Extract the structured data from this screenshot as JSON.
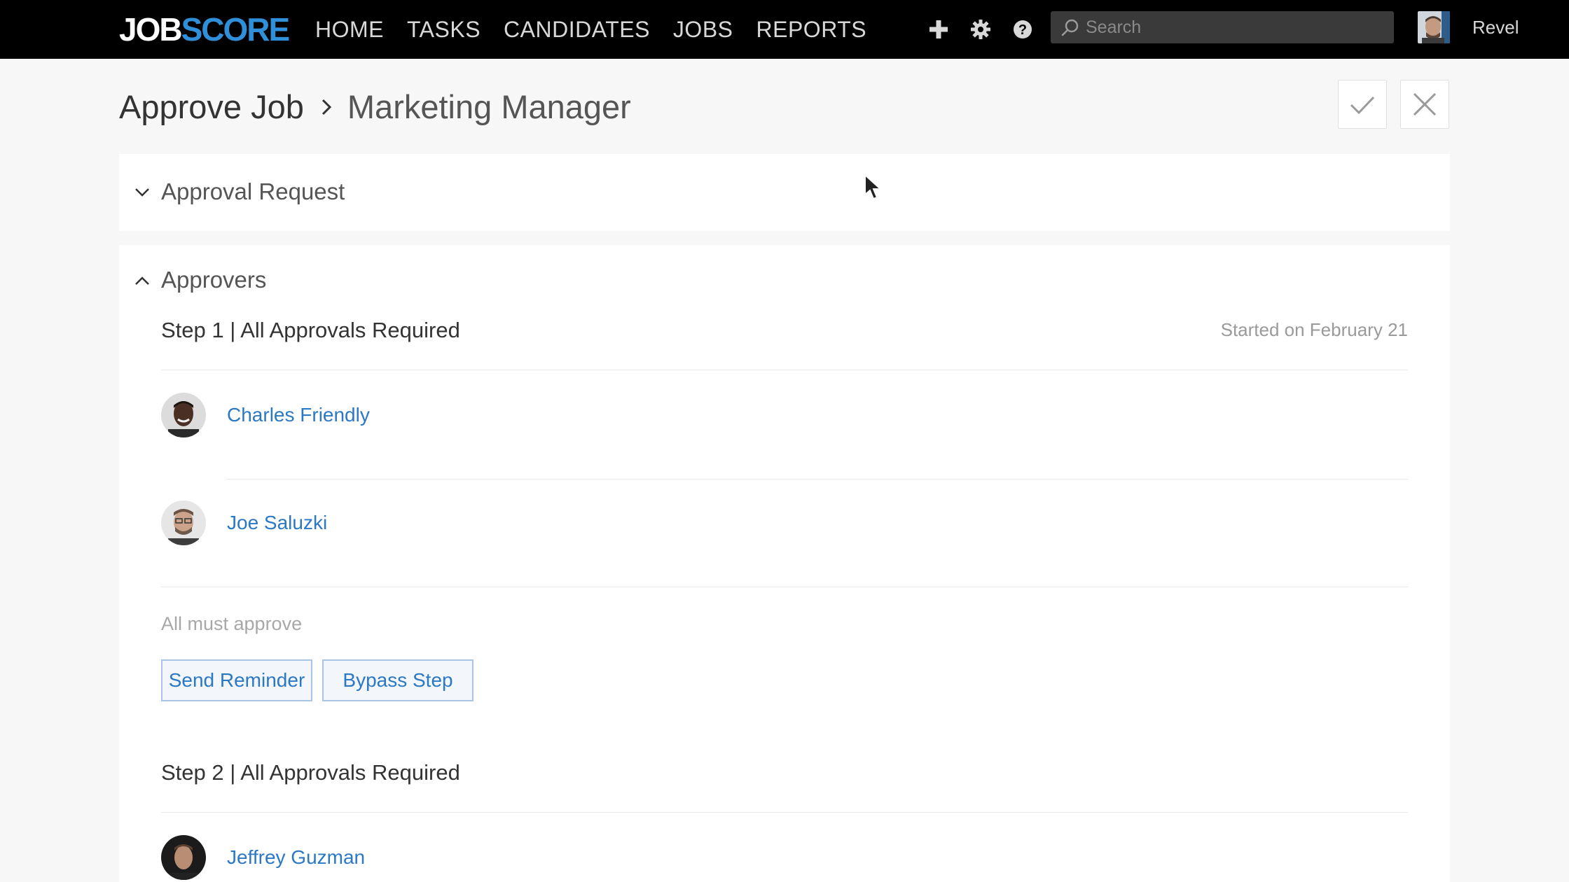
{
  "app": {
    "logo_part1": "JOB",
    "logo_part2": "SCORE"
  },
  "nav": {
    "items": [
      {
        "label": "HOME"
      },
      {
        "label": "TASKS"
      },
      {
        "label": "CANDIDATES"
      },
      {
        "label": "JOBS"
      },
      {
        "label": "REPORTS"
      }
    ],
    "icons": [
      "plus-icon",
      "gear-icon",
      "help-icon"
    ]
  },
  "search": {
    "placeholder": "Search",
    "value": ""
  },
  "user": {
    "name": "Revel"
  },
  "header": {
    "breadcrumb_parent": "Approve Job",
    "breadcrumb_current": "Marketing Manager",
    "actions": [
      "approve-check-icon",
      "reject-x-icon"
    ]
  },
  "approval_request": {
    "title": "Approval Request",
    "expanded": false
  },
  "approvers": {
    "title": "Approvers",
    "expanded": true,
    "steps": [
      {
        "title": "Step 1 | All Approvals Required",
        "started": "Started on February 21",
        "people": [
          {
            "name": "Charles Friendly"
          },
          {
            "name": "Joe Saluzki"
          }
        ],
        "rule": "All must approve",
        "buttons": {
          "send_reminder": "Send Reminder",
          "bypass_step": "Bypass Step"
        }
      },
      {
        "title": "Step 2 | All Approvals Required",
        "people": [
          {
            "name": "Jeffrey Guzman"
          }
        ]
      }
    ]
  },
  "colors": {
    "topbar": "#000000",
    "logo_accent": "#2f8fd9",
    "link": "#2b78c5",
    "background": "#f7f7f7"
  }
}
